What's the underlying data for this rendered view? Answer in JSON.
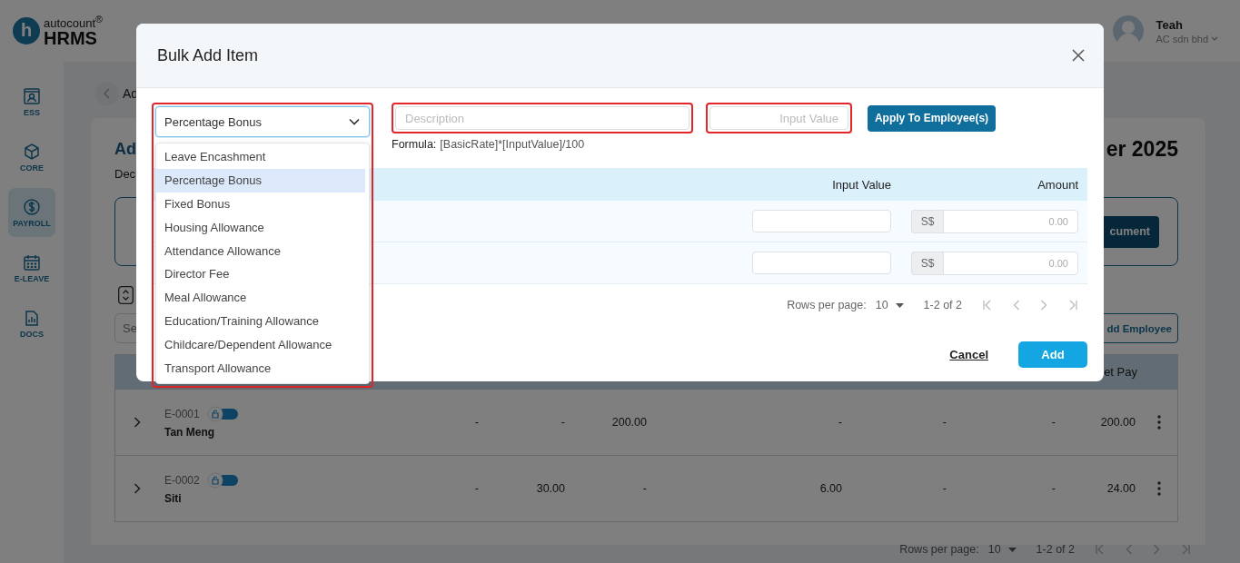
{
  "header": {
    "logo": {
      "mark": "h",
      "brand": "autocount$^{®}$",
      "product": "HRMS"
    },
    "user": {
      "name": "Teah",
      "company": "AC sdn bhd"
    }
  },
  "sidebar": {
    "items": [
      {
        "label": "ESS",
        "selected": false
      },
      {
        "label": "CORE",
        "selected": false
      },
      {
        "label": "PAYROLL",
        "selected": true
      },
      {
        "label": "E-LEAVE",
        "selected": false
      },
      {
        "label": "DOCS",
        "selected": false
      }
    ]
  },
  "page": {
    "heading": "Ad",
    "title_start": "Ad",
    "title_end": "er 2025",
    "subtitle": "Dec",
    "document_button": "cument",
    "search_placeholder": "Se",
    "add_employee_button": "dd Employee",
    "table": {
      "last_column": "et Pay",
      "rows": [
        {
          "id": "E-0001",
          "name": "Tan Meng",
          "toggle_on": true,
          "values": [
            "-",
            "-",
            "200.00",
            "-",
            "-",
            "-",
            "200.00"
          ]
        },
        {
          "id": "E-0002",
          "name": "Siti",
          "toggle_on": true,
          "values": [
            "-",
            "30.00",
            "-",
            "6.00",
            "-",
            "-",
            "24.00"
          ]
        }
      ]
    },
    "pagination": {
      "label": "Rows per page:",
      "rows_per_page": "10",
      "range": "1-2 of 2"
    }
  },
  "dialog": {
    "title": "Bulk Add Item",
    "item_select": {
      "value": "Percentage Bonus",
      "highlighted": true,
      "options": [
        {
          "label": "Leave Encashment",
          "selected": false
        },
        {
          "label": "Percentage Bonus",
          "selected": true
        },
        {
          "label": "Fixed Bonus",
          "selected": false
        },
        {
          "label": "Housing Allowance",
          "selected": false
        },
        {
          "label": "Attendance Allowance",
          "selected": false
        },
        {
          "label": "Director Fee",
          "selected": false
        },
        {
          "label": "Meal Allowance",
          "selected": false
        },
        {
          "label": "Education/Training Allowance",
          "selected": false
        },
        {
          "label": "Childcare/Dependent Allowance",
          "selected": false
        },
        {
          "label": "Transport Allowance",
          "selected": false
        }
      ]
    },
    "description": {
      "placeholder": "Description",
      "highlighted": true
    },
    "input_value": {
      "placeholder": "Input Value",
      "highlighted": true
    },
    "apply_button": "Apply To Employee(s)",
    "formula": {
      "label": "Formula:",
      "expression": "[BasicRate]*[InputValue]/100"
    },
    "table": {
      "columns": [
        "Input Value",
        "Amount"
      ],
      "rows": [
        {
          "currency": "S$",
          "amount_placeholder": "0.00"
        },
        {
          "currency": "S$",
          "amount_placeholder": "0.00"
        }
      ]
    },
    "pagination": {
      "label": "Rows per page:",
      "rows_per_page": "10",
      "range": "1-2 of 2"
    },
    "cancel_button": "Cancel",
    "add_button": "Add"
  }
}
